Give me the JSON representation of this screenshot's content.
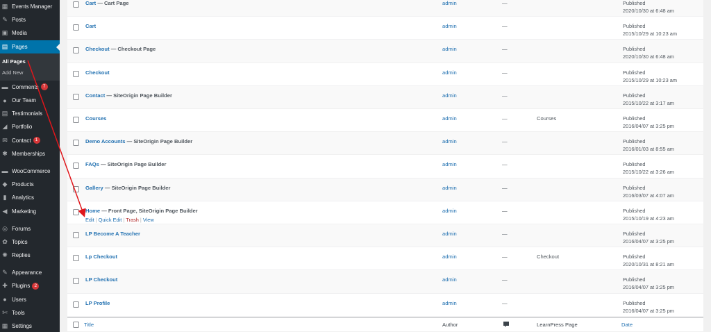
{
  "sidebar": {
    "items": [
      {
        "label": "Events Manager",
        "icon": "calendar-icon",
        "glyph": "▦"
      },
      {
        "label": "Posts",
        "icon": "pin-icon",
        "glyph": "✎"
      },
      {
        "label": "Media",
        "icon": "media-icon",
        "glyph": "▣"
      },
      {
        "label": "Pages",
        "icon": "pages-icon",
        "glyph": "▤",
        "active": true
      }
    ],
    "submenu": {
      "all_pages": "All Pages",
      "add_new": "Add New"
    },
    "items2": [
      {
        "label": "Comments",
        "icon": "comment-icon",
        "glyph": "▬",
        "badge": "7"
      },
      {
        "label": "Our Team",
        "icon": "team-icon",
        "glyph": "●"
      },
      {
        "label": "Testimonials",
        "icon": "testimonial-icon",
        "glyph": "▤"
      },
      {
        "label": "Portfolio",
        "icon": "portfolio-icon",
        "glyph": "◢"
      },
      {
        "label": "Contact",
        "icon": "mail-icon",
        "glyph": "✉",
        "badge": "1"
      },
      {
        "label": "Memberships",
        "icon": "memberships-icon",
        "glyph": "✱"
      }
    ],
    "items3": [
      {
        "label": "WooCommerce",
        "icon": "woocommerce-icon",
        "glyph": "▬"
      },
      {
        "label": "Products",
        "icon": "products-icon",
        "glyph": "◆"
      },
      {
        "label": "Analytics",
        "icon": "analytics-icon",
        "glyph": "▮"
      },
      {
        "label": "Marketing",
        "icon": "megaphone-icon",
        "glyph": "◀"
      }
    ],
    "items4": [
      {
        "label": "Forums",
        "icon": "forums-icon",
        "glyph": "◎"
      },
      {
        "label": "Topics",
        "icon": "topics-icon",
        "glyph": "✿"
      },
      {
        "label": "Replies",
        "icon": "replies-icon",
        "glyph": "✺"
      }
    ],
    "items5": [
      {
        "label": "Appearance",
        "icon": "appearance-icon",
        "glyph": "✎"
      },
      {
        "label": "Plugins",
        "icon": "plugins-icon",
        "glyph": "✚",
        "badge": "2"
      },
      {
        "label": "Users",
        "icon": "users-icon",
        "glyph": "●"
      },
      {
        "label": "Tools",
        "icon": "tools-icon",
        "glyph": "✄"
      },
      {
        "label": "Settings",
        "icon": "settings-icon",
        "glyph": "▦"
      }
    ]
  },
  "rows": [
    {
      "title": "Cart",
      "state": " — Cart Page",
      "author": "admin",
      "comments": "—",
      "lp": "",
      "status": "Published",
      "date": "2020/10/30 at 6:48 am"
    },
    {
      "title": "Cart",
      "state": "",
      "author": "admin",
      "comments": "—",
      "lp": "",
      "status": "Published",
      "date": "2015/10/29 at 10:23 am"
    },
    {
      "title": "Checkout",
      "state": " — Checkout Page",
      "author": "admin",
      "comments": "—",
      "lp": "",
      "status": "Published",
      "date": "2020/10/30 at 6:48 am"
    },
    {
      "title": "Checkout",
      "state": "",
      "author": "admin",
      "comments": "—",
      "lp": "",
      "status": "Published",
      "date": "2015/10/29 at 10:23 am"
    },
    {
      "title": "Contact",
      "state": " — SiteOrigin Page Builder",
      "author": "admin",
      "comments": "—",
      "lp": "",
      "status": "Published",
      "date": "2015/10/22 at 3:17 am"
    },
    {
      "title": "Courses",
      "state": "",
      "author": "admin",
      "comments": "—",
      "lp": "Courses",
      "status": "Published",
      "date": "2016/04/07 at 3:25 pm"
    },
    {
      "title": "Demo Accounts",
      "state": " — SiteOrigin Page Builder",
      "author": "admin",
      "comments": "—",
      "lp": "",
      "status": "Published",
      "date": "2016/01/03 at 8:55 am"
    },
    {
      "title": "FAQs",
      "state": " — SiteOrigin Page Builder",
      "author": "admin",
      "comments": "—",
      "lp": "",
      "status": "Published",
      "date": "2015/10/22 at 3:26 am"
    },
    {
      "title": "Gallery",
      "state": " — SiteOrigin Page Builder",
      "author": "admin",
      "comments": "—",
      "lp": "",
      "status": "Published",
      "date": "2016/03/07 at 4:07 am"
    },
    {
      "title": "Home",
      "state": " — Front Page, SiteOrigin Page Builder",
      "author": "admin",
      "comments": "—",
      "lp": "",
      "status": "Published",
      "date": "2015/10/19 at 4:23 am",
      "hover": true
    },
    {
      "title": "LP Become A Teacher",
      "state": "",
      "author": "admin",
      "comments": "—",
      "lp": "",
      "status": "Published",
      "date": "2016/04/07 at 3:25 pm"
    },
    {
      "title": "Lp Checkout",
      "state": "",
      "author": "admin",
      "comments": "—",
      "lp": "Checkout",
      "status": "Published",
      "date": "2020/10/31 at 8:21 am"
    },
    {
      "title": "LP Checkout",
      "state": "",
      "author": "admin",
      "comments": "—",
      "lp": "",
      "status": "Published",
      "date": "2016/04/07 at 3:25 pm"
    },
    {
      "title": "LP Profile",
      "state": "",
      "author": "admin",
      "comments": "—",
      "lp": "",
      "status": "Published",
      "date": "2016/04/07 at 3:25 pm"
    }
  ],
  "row_actions": {
    "edit": "Edit",
    "quick_edit": "Quick Edit",
    "trash": "Trash",
    "view": "View"
  },
  "footer": {
    "title": "Title",
    "author": "Author",
    "lp_page": "LearnPress Page",
    "date": "Date"
  },
  "colors": {
    "accent": "#0073aa",
    "link": "#2271b1",
    "annotation_arrow": "#e0161b"
  }
}
